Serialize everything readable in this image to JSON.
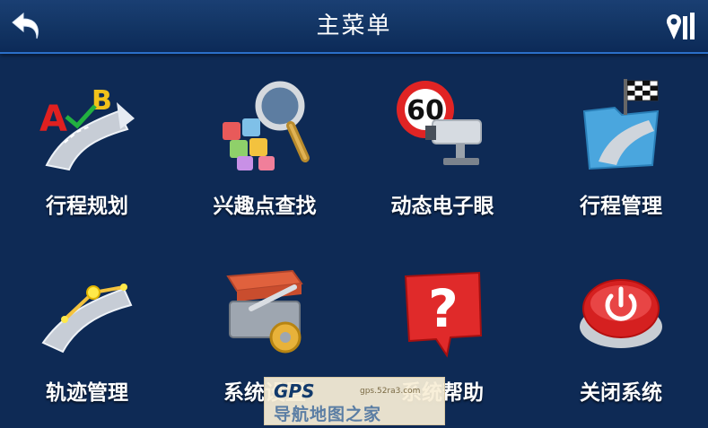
{
  "header": {
    "title": "主菜单",
    "back_icon": "back-arrow-icon",
    "badge_icon": "signal-badge-icon"
  },
  "menu": [
    {
      "label": "行程规划",
      "icon": "route-planning-icon"
    },
    {
      "label": "兴趣点查找",
      "icon": "poi-search-icon"
    },
    {
      "label": "动态电子眼",
      "icon": "speed-camera-icon"
    },
    {
      "label": "行程管理",
      "icon": "trip-management-icon"
    },
    {
      "label": "轨迹管理",
      "icon": "track-management-icon"
    },
    {
      "label": "系统设置",
      "icon": "system-settings-icon"
    },
    {
      "label": "系统帮助",
      "icon": "help-icon"
    },
    {
      "label": "关闭系统",
      "icon": "power-off-icon"
    }
  ],
  "watermark": {
    "brand": "GPS",
    "site": "gps.52ra3.com",
    "name": "导航地图之家"
  },
  "colors": {
    "background": "#0e2a55",
    "titlebar": "#123463",
    "accent_line": "#2b6fc8"
  }
}
